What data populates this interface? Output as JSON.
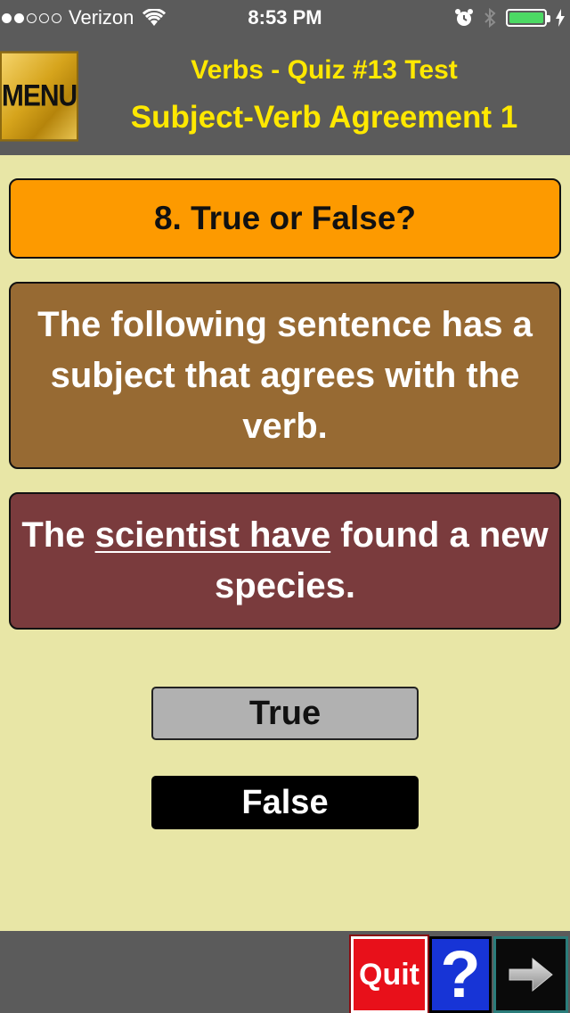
{
  "status_bar": {
    "carrier": "Verizon",
    "time": "8:53 PM",
    "signal_bars_filled": 2,
    "signal_bars_total": 5,
    "battery_level": 1.0,
    "battery_color": "#4cd964"
  },
  "header": {
    "menu_label": "MENU",
    "title": "Verbs - Quiz #13 Test",
    "subtitle": "Subject-Verb Agreement 1",
    "title_color": "#ffe800"
  },
  "question": {
    "number_label": "8. True or False?",
    "statement": "The following sentence has a subject that agrees with the verb.",
    "sentence": {
      "before": "The ",
      "underlined": "scientist have",
      "after": " found a new species."
    }
  },
  "answers": {
    "true_label": "True",
    "false_label": "False"
  },
  "toolbar": {
    "quit_label": "Quit",
    "help_label": "?",
    "next_icon": "right-arrow-icon"
  },
  "colors": {
    "background": "#e8e6a6",
    "bar_gray": "#5b5b5b",
    "question_number_bg": "#fd9a00",
    "statement_bg": "#976a33",
    "sentence_bg": "#7a3b3d",
    "quit_bg": "#e8101a",
    "help_bg": "#1734d6"
  }
}
